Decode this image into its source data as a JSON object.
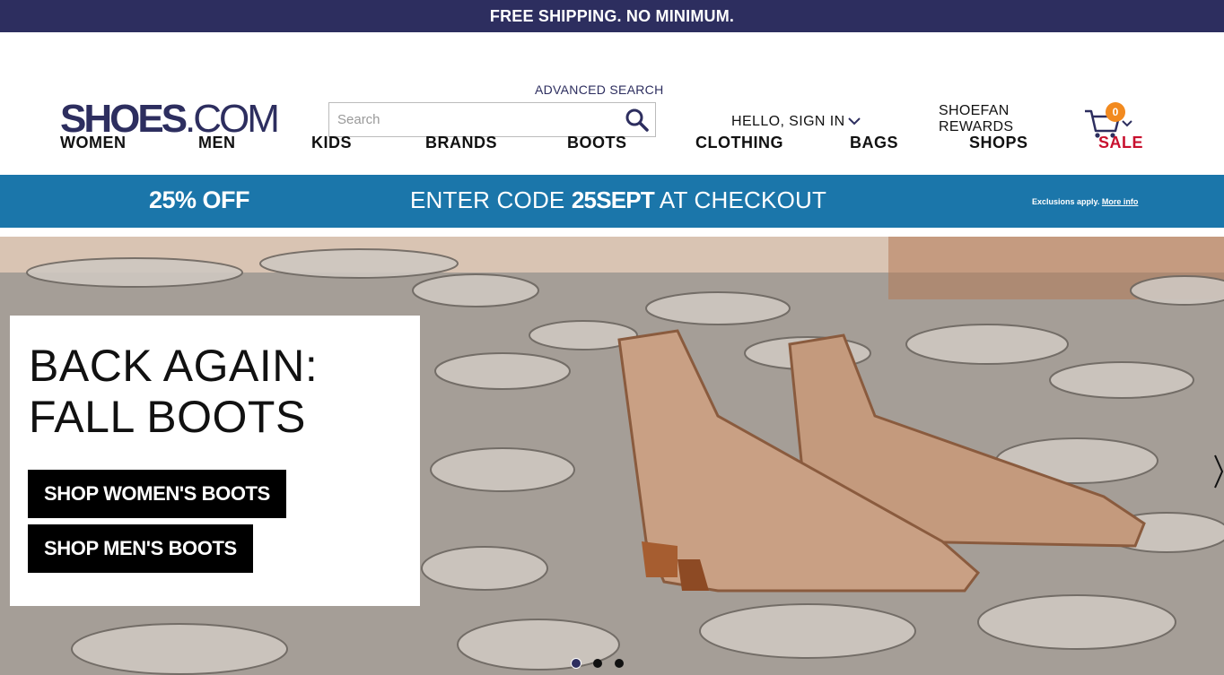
{
  "topbar": {
    "text": "FREE SHIPPING. NO MINIMUM."
  },
  "header": {
    "logo_bold": "SHOES",
    "logo_thin": ".COM",
    "advanced_search": "ADVANCED SEARCH",
    "search_placeholder": "Search",
    "signin": "HELLO, SIGN IN",
    "rewards_line1": "SHOEFAN",
    "rewards_line2": "REWARDS",
    "cart_count": "0",
    "icons": {
      "search": "search-icon",
      "cart": "cart-icon",
      "chevron": "chevron-down-icon"
    }
  },
  "nav": {
    "items": [
      "WOMEN",
      "MEN",
      "KIDS",
      "BRANDS",
      "BOOTS",
      "CLOTHING",
      "BAGS",
      "SHOPS",
      "SALE"
    ]
  },
  "promo": {
    "discount": "25% OFF",
    "code_prefix": "ENTER CODE ",
    "code": "25SEPT",
    "code_suffix": " AT CHECKOUT",
    "exclusions": "Exclusions apply.",
    "more_info": "More info"
  },
  "hero": {
    "title_line1": "BACK AGAIN:",
    "title_line2": "FALL BOOTS",
    "button_women": "SHOP WOMEN'S BOOTS",
    "button_men": "SHOP MEN'S BOOTS",
    "slide_count": 3,
    "active_slide": 1
  },
  "colors": {
    "brand_navy": "#2d2e5f",
    "promo_blue": "#1b76aa",
    "sale_red": "#c8102e",
    "badge_orange": "#f28a1f"
  }
}
